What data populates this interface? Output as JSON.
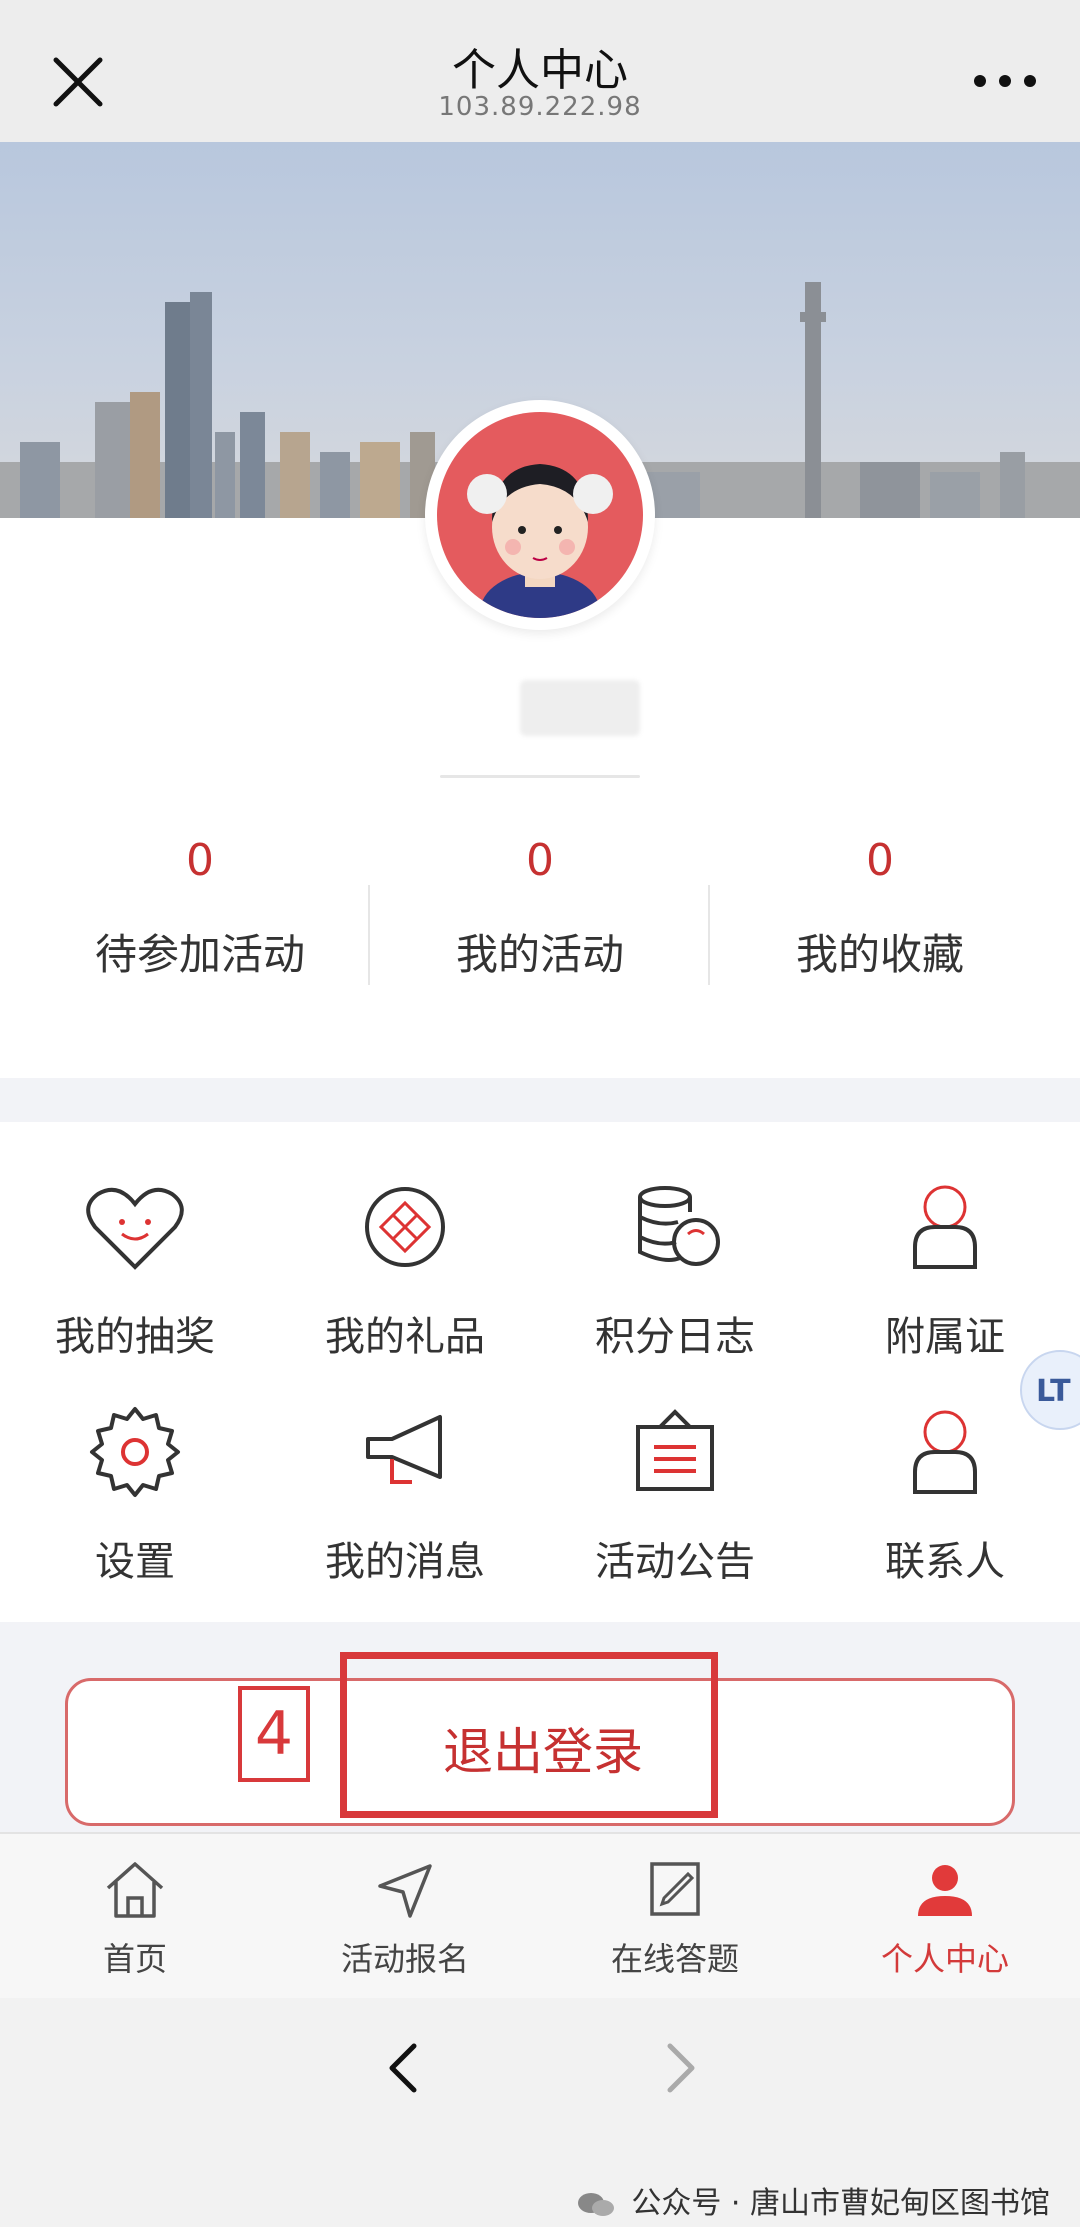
{
  "header": {
    "title": "个人中心",
    "subtitle": "103.89.222.98"
  },
  "stats": [
    {
      "value": "0",
      "label": "待参加活动"
    },
    {
      "value": "0",
      "label": "我的活动"
    },
    {
      "value": "0",
      "label": "我的收藏"
    }
  ],
  "menu": [
    {
      "label": "我的抽奖",
      "icon": "heart-smile-icon"
    },
    {
      "label": "我的礼品",
      "icon": "gift-icon"
    },
    {
      "label": "积分日志",
      "icon": "coins-icon"
    },
    {
      "label": "附属证",
      "icon": "person-icon"
    },
    {
      "label": "设置",
      "icon": "gear-icon"
    },
    {
      "label": "我的消息",
      "icon": "megaphone-icon"
    },
    {
      "label": "活动公告",
      "icon": "notice-board-icon"
    },
    {
      "label": "联系人",
      "icon": "contact-person-icon"
    }
  ],
  "logout": {
    "label": "退出登录",
    "step_number": "4"
  },
  "tabs": [
    {
      "label": "首页",
      "icon": "home-icon"
    },
    {
      "label": "活动报名",
      "icon": "send-icon"
    },
    {
      "label": "在线答题",
      "icon": "edit-icon"
    },
    {
      "label": "个人中心",
      "icon": "user-icon",
      "active": true
    }
  ],
  "float_tab": {
    "label": "LT"
  },
  "watermark": {
    "text": "公众号 · 唐山市曹妃甸区图书馆"
  },
  "colors": {
    "accent": "#c63131",
    "highlight": "#d8393b"
  }
}
